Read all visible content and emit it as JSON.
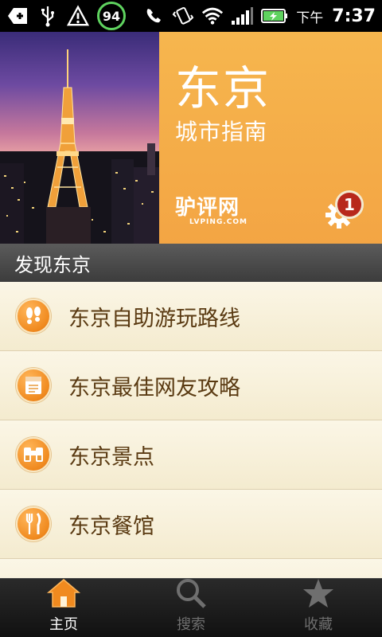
{
  "status_bar": {
    "battery_badge": "94",
    "ampm": "下午",
    "time": "7:37",
    "icons": [
      "notification-plus-icon",
      "usb-icon",
      "warning-icon",
      "battery-percent-badge",
      "missed-call-icon",
      "vibrate-icon",
      "wifi-icon",
      "signal-icon",
      "battery-charging-icon"
    ]
  },
  "hero": {
    "city_title": "东京",
    "city_subtitle": "城市指南",
    "logo_text": "驴评网",
    "logo_sub": "LVPING.COM",
    "notification_count": "1"
  },
  "section": {
    "title": "发现东京"
  },
  "list": {
    "items": [
      {
        "label": "东京自助游玩路线",
        "icon": "footprints-icon"
      },
      {
        "label": "东京最佳网友攻略",
        "icon": "guidebook-icon"
      },
      {
        "label": "东京景点",
        "icon": "binoculars-icon"
      },
      {
        "label": "东京餐馆",
        "icon": "fork-knife-icon"
      }
    ]
  },
  "tabbar": {
    "tabs": [
      {
        "label": "主页",
        "icon": "home-icon",
        "active": true
      },
      {
        "label": "搜索",
        "icon": "search-icon",
        "active": false
      },
      {
        "label": "收藏",
        "icon": "star-icon",
        "active": false
      }
    ]
  },
  "colors": {
    "accent_orange": "#f3a544",
    "text_brown": "#5a3a12",
    "badge_red": "#b8281c",
    "status_green": "#5fd35f"
  }
}
